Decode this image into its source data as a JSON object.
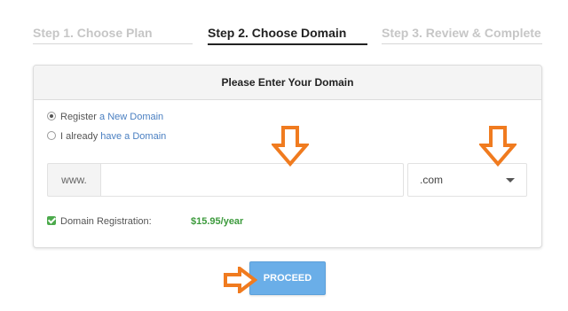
{
  "steps": [
    {
      "label": "Step 1. Choose Plan",
      "state": "inactive"
    },
    {
      "label": "Step 2. Choose Domain",
      "state": "active"
    },
    {
      "label": "Step 3. Review & Complete",
      "state": "inactive"
    }
  ],
  "panel": {
    "title": "Please Enter Your Domain",
    "option_register": {
      "prefix": "Register",
      "link": "a New Domain",
      "selected": true
    },
    "option_existing": {
      "prefix": "I already",
      "link": "have a Domain",
      "selected": false
    },
    "www_prefix": "www.",
    "domain_value": "",
    "domain_placeholder": "",
    "tld_selected": ".com",
    "registration": {
      "label": "Domain Registration:",
      "checked": true,
      "price": "$15.95/year"
    }
  },
  "proceed_label": "PROCEED",
  "colors": {
    "arrow": "#f07b1f",
    "button": "#6aaee8",
    "price": "#3c9a3c",
    "link": "#4a7fc1"
  },
  "icons": [
    "down-arrow-icon",
    "right-arrow-icon",
    "chevron-down-icon"
  ]
}
